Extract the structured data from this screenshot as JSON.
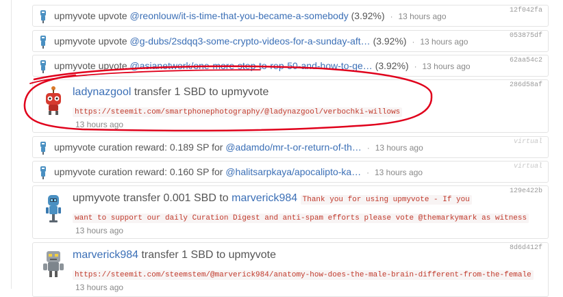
{
  "feed": {
    "items": [
      {
        "type": "vote",
        "actor": "upmyvote",
        "verb": "upvote",
        "target": "@reonlouw/it-is-time-that-you-became-a-somebody",
        "percent": "(3.92%)",
        "time": "13 hours ago",
        "txid": "12f042fa"
      },
      {
        "type": "vote",
        "actor": "upmyvote",
        "verb": "upvote",
        "target": "@g-dubs/2sdqq3-some-crypto-videos-for-a-sunday-aft…",
        "percent": "(3.92%)",
        "time": "13 hours ago",
        "txid": "053875df"
      },
      {
        "type": "vote",
        "actor": "upmyvote",
        "verb": "upvote",
        "target": "@asianetwork/one-more-step-to-rep-50-and-how-to-ge…",
        "percent": "(3.92%)",
        "time": "13 hours ago",
        "txid": "62aa54c2"
      },
      {
        "type": "transfer",
        "from": "ladynazgool",
        "text": "transfer 1 SBD to",
        "to": "upmyvote",
        "memo": "https://steemit.com/smartphonephotography/@ladynazgool/verbochki-willows",
        "time": "13 hours ago",
        "txid": "286d58af"
      },
      {
        "type": "curation",
        "actor": "upmyvote",
        "text": "curation reward: 0.189 SP for",
        "target": "@adamdo/mr-t-or-return-of-th…",
        "time": "13 hours ago",
        "txid": "virtual"
      },
      {
        "type": "curation",
        "actor": "upmyvote",
        "text": "curation reward: 0.160 SP for",
        "target": "@halitsarpkaya/apocalipto-ka…",
        "time": "13 hours ago",
        "txid": "virtual"
      },
      {
        "type": "transfer",
        "from": "upmyvote",
        "text": "transfer 0.001 SBD to",
        "to": "marverick984",
        "memo_part1": "Thank you for using upmyvote - If you",
        "memo_part2": "want to support our daily Curation Digest and anti-spam efforts please vote @themarkymark as witness",
        "time": "13 hours ago",
        "txid": "129e422b"
      },
      {
        "type": "transfer",
        "from": "marverick984",
        "text": "transfer 1 SBD to",
        "to": "upmyvote",
        "memo": "https://steemit.com/steemstem/@marverick984/anatomy-how-does-the-male-brain-different-from-the-female",
        "time": "13 hours ago",
        "txid": "8d6d412f"
      }
    ]
  },
  "colors": {
    "link": "#3b6fb6",
    "memo": "#c0392b",
    "annotation": "#e0001b"
  },
  "icons": {
    "robot_small": "robot-avatar-icon",
    "annotation": "red-hand-drawn-circle"
  }
}
